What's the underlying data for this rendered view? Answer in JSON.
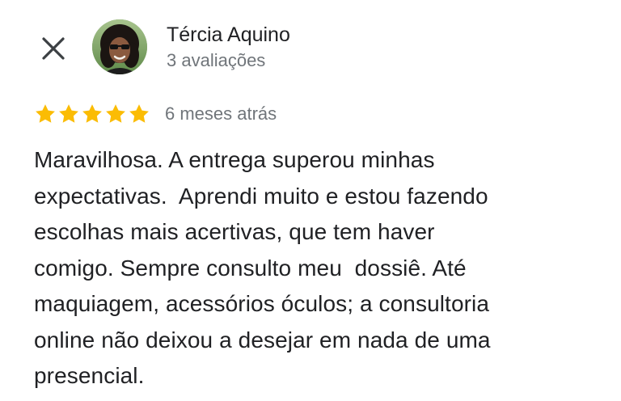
{
  "header": {
    "close_icon": "close-icon",
    "reviewer": {
      "name": "Tércia Aquino",
      "review_count": "3 avaliações",
      "avatar": "avatar-photo"
    }
  },
  "review": {
    "rating": 5,
    "rating_max": 5,
    "star_color": "#fbbc04",
    "date": "6 meses atrás",
    "text": "Maravilhosa. A entrega superou minhas\nexpectativas.  Aprendi muito e estou fazendo\nescolhas mais acertivas, que tem haver\ncomigo. Sempre consulto meu  dossiê. Até\nmaquiagem, acessórios óculos; a consultoria\nonline não deixou a desejar em nada de uma\npresencial."
  }
}
